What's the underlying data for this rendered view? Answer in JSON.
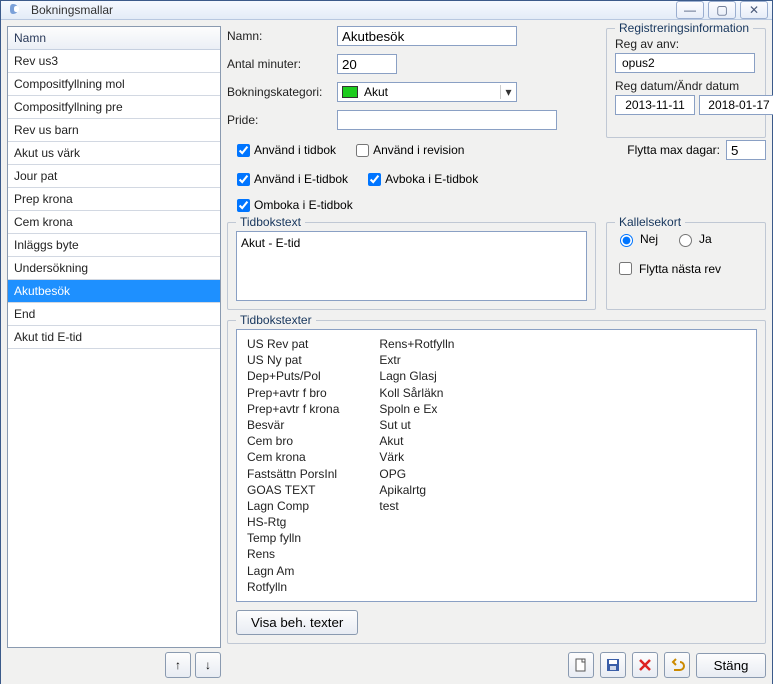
{
  "window": {
    "title": "Bokningsmallar"
  },
  "list": {
    "header": "Namn",
    "items": [
      "Rev us3",
      "Compositfyllning mol",
      "Compositfyllning pre",
      "Rev us barn",
      "Akut us värk",
      "Jour pat",
      "Prep krona",
      "Cem krona",
      "Inläggs byte",
      "Undersökning",
      "Akutbesök",
      "End",
      "Akut tid E-tid"
    ],
    "selected_index": 10
  },
  "form": {
    "labels": {
      "namn": "Namn:",
      "minuter": "Antal minuter:",
      "kategori": "Bokningskategori:",
      "pride": "Pride:",
      "flytta": "Flytta max dagar:"
    },
    "namn": "Akutbesök",
    "minuter": "20",
    "kategori": "Akut",
    "pride": "",
    "flytta": "5"
  },
  "reg": {
    "title": "Registreringsinformation",
    "anv_label": "Reg av anv:",
    "anv": "opus2",
    "date_label": "Reg datum/Ändr datum",
    "date1": "2013-11-11",
    "date2": "2018-01-17"
  },
  "checks": {
    "c1": "Använd i tidbok",
    "c2": "Använd i revision",
    "c3": "Använd i E-tidbok",
    "c4": "Avboka i E-tidbok",
    "c5": "Omboka i E-tidbok"
  },
  "tidbokstext": {
    "title": "Tidbokstext",
    "value": "Akut - E-tid"
  },
  "kallelse": {
    "title": "Kallelsekort",
    "nej": "Nej",
    "ja": "Ja",
    "flytta": "Flytta nästa rev"
  },
  "texter": {
    "title": "Tidbokstexter",
    "col1": [
      "US Rev pat",
      "US Ny pat",
      "Dep+Puts/Pol",
      "Prep+avtr f bro",
      "Prep+avtr f krona",
      "Besvär",
      "Cem bro",
      "Cem krona",
      "Fastsättn PorsInl",
      "GOAS TEXT",
      "Lagn Comp",
      "HS-Rtg",
      "Temp fylln",
      "Rens",
      "Lagn Am",
      "Rotfylln"
    ],
    "col2": [
      "Rens+Rotfylln",
      "Extr",
      "Lagn Glasj",
      "Koll Sårläkn",
      "Spoln e Ex",
      "Sut ut",
      "Akut",
      "Värk",
      "OPG",
      "Apikalrtg",
      "test"
    ]
  },
  "buttons": {
    "visa": "Visa beh. texter",
    "stang": "Stäng"
  }
}
